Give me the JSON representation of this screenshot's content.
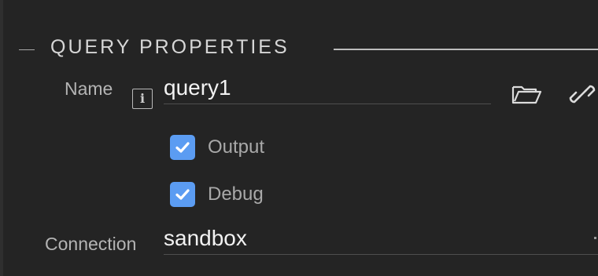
{
  "section": {
    "title": "QUERY PROPERTIES"
  },
  "name_field": {
    "label": "Name",
    "value": "query1",
    "info_icon": "info-icon",
    "folder_icon": "folder-open-icon",
    "link_icon": "link-icon"
  },
  "options": [
    {
      "label": "Output",
      "checked": true
    },
    {
      "label": "Debug",
      "checked": true
    }
  ],
  "connection_field": {
    "label": "Connection",
    "value": "sandbox"
  },
  "colors": {
    "background": "#242424",
    "checkbox_accent": "#5b9cf2",
    "label_text": "#b4b4b4",
    "value_text": "#f2f2f2"
  }
}
